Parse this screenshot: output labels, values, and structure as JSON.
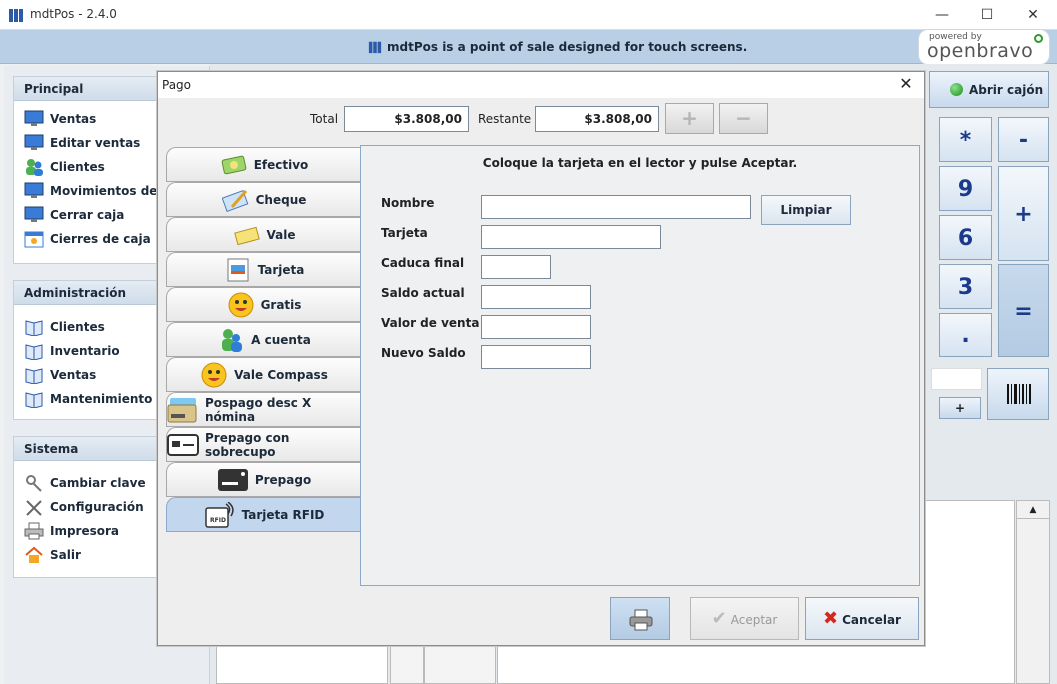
{
  "window": {
    "title": "mdtPos - 2.4.0",
    "minimize": "—",
    "maximize": "☐",
    "close": "✕"
  },
  "banner": {
    "text": "mdtPos is a point of sale designed for touch screens.",
    "logo_small": "powered by",
    "logo_big": "openbravo"
  },
  "menu": {
    "principal": {
      "header": "Principal",
      "items": [
        "Ventas",
        "Editar ventas",
        "Clientes",
        "Movimientos de caja",
        "Cerrar caja",
        "Cierres de caja"
      ]
    },
    "administracion": {
      "header": "Administración",
      "items": [
        "Clientes",
        "Inventario",
        "Ventas",
        "Mantenimiento"
      ]
    },
    "sistema": {
      "header": "Sistema",
      "items": [
        "Cambiar clave",
        "Configuración",
        "Impresora",
        "Salir"
      ]
    }
  },
  "background": {
    "abrir_cajon": "Abrir cajón",
    "keys": [
      "*",
      "-",
      "9",
      "+",
      "6",
      "3",
      "=",
      "."
    ],
    "small_plus": "+"
  },
  "dialog": {
    "title": "Pago",
    "close": "✕",
    "total_label": "Total",
    "total_value": "$3.808,00",
    "restante_label": "Restante",
    "restante_value": "$3.808,00",
    "plus_btn": "+",
    "minus_btn": "−",
    "tabs": [
      {
        "label": "Efectivo",
        "icon": "cash-icon"
      },
      {
        "label": "Cheque",
        "icon": "cheque-icon"
      },
      {
        "label": "Vale",
        "icon": "voucher-icon"
      },
      {
        "label": "Tarjeta",
        "icon": "card-icon"
      },
      {
        "label": "Gratis",
        "icon": "smiley-icon"
      },
      {
        "label": "A cuenta",
        "icon": "account-icon"
      },
      {
        "label": "Vale Compass",
        "icon": "smiley-icon"
      },
      {
        "label": "Pospago desc X nómina",
        "icon": "payroll-card-icon"
      },
      {
        "label": "Prepago con sobrecupo",
        "icon": "prepaid-card-icon"
      },
      {
        "label": "Prepago",
        "icon": "prepaid-icon"
      },
      {
        "label": "Tarjeta RFID",
        "icon": "rfid-icon"
      }
    ],
    "instruction": "Coloque la tarjeta en el lector y pulse Aceptar.",
    "fields": {
      "nombre": "Nombre",
      "tarjeta": "Tarjeta",
      "caduca": "Caduca final",
      "saldo_actual": "Saldo actual",
      "valor_venta": "Valor de venta",
      "nuevo_saldo": "Nuevo Saldo"
    },
    "limpiar": "Limpiar",
    "aceptar": "Aceptar",
    "cancelar": "Cancelar"
  }
}
